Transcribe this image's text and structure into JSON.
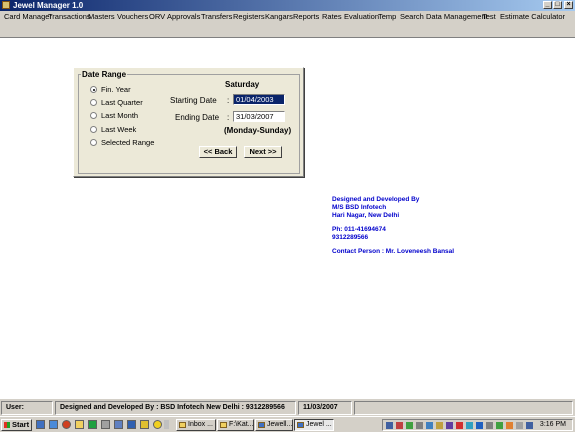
{
  "window": {
    "title": "Jewel Manager 1.0"
  },
  "menu": [
    "Card Manager",
    "Transactions",
    "Masters",
    "Vouchers",
    "ORV",
    "Approvals",
    "Transfers",
    "Registers",
    "Kangars",
    "Reports",
    "Rates",
    "Evaluation",
    "Temp",
    "Search",
    "Data Management",
    "Test",
    "Estimate Calculator"
  ],
  "date_range": {
    "title": "Date Range",
    "options": [
      {
        "label": "Fin. Year",
        "selected": true
      },
      {
        "label": "Last Quarter",
        "selected": false
      },
      {
        "label": "Last Month",
        "selected": false
      },
      {
        "label": "Last Week",
        "selected": false
      },
      {
        "label": "Selected Range",
        "selected": false
      }
    ],
    "day_label": "Saturday",
    "starting_label": "Starting Date",
    "starting_value": "01/04/2003",
    "ending_label": "Ending Date",
    "ending_value": "31/03/2007",
    "colon": ":",
    "week_note": "(Monday-Sunday)",
    "back_label": "<< Back",
    "next_label": "Next >>"
  },
  "credits": {
    "line1": "Designed and Developed By",
    "line2": "M/S BSD Infotech",
    "line3": "Hari Nagar, New Delhi",
    "phone1": "Ph: 011-41694674",
    "phone2": "9312289566",
    "contact": "Contact Person : Mr. Loveneesh Bansal"
  },
  "status": {
    "user": "User:",
    "dev": "Designed and Developed By : BSD Infotech New Delhi : 9312289566",
    "date": "11/03/2007"
  },
  "taskbar": {
    "start": "Start",
    "tasks": [
      "Inbox ...",
      "F:\\Kat...",
      "Jewell...",
      "Jewel ..."
    ],
    "clock": "3:16 PM"
  },
  "colors": {
    "credits": "#0000cc",
    "titlebar": "#0a246a",
    "selection": "#0a246a"
  }
}
